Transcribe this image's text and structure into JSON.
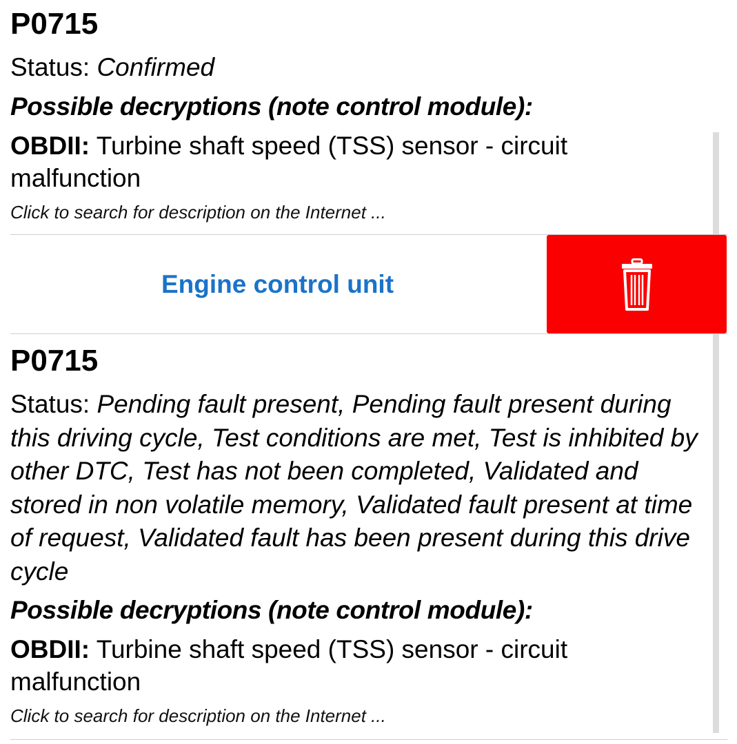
{
  "entries": [
    {
      "code": "P0715",
      "status_label": "Status: ",
      "status_value": "Confirmed",
      "decryptions_heading": "Possible decryptions (note control module):",
      "obd_label": "OBDII:",
      "obd_description": " Turbine shaft speed (TSS) sensor - circuit malfunction",
      "search_link": "Click to search for description on the Internet ..."
    },
    {
      "code": "P0715",
      "status_label": "Status: ",
      "status_value": "Pending fault present, Pending fault present during this driving cycle, Test conditions are met, Test is inhibited by other DTC, Test has not been completed, Validated and stored in non volatile memory, Validated fault present at time of request, Validated fault has been present during this drive cycle",
      "decryptions_heading": "Possible decryptions (note control module):",
      "obd_label": "OBDII:",
      "obd_description": " Turbine shaft speed (TSS) sensor - circuit malfunction",
      "search_link": "Click to search for description on the Internet ..."
    }
  ],
  "module_row": {
    "label": "Engine control unit",
    "delete_icon": "trash-icon"
  },
  "colors": {
    "link_blue": "#1a73c8",
    "delete_red": "#fb0000",
    "scrollbar": "#dcdcdc"
  }
}
